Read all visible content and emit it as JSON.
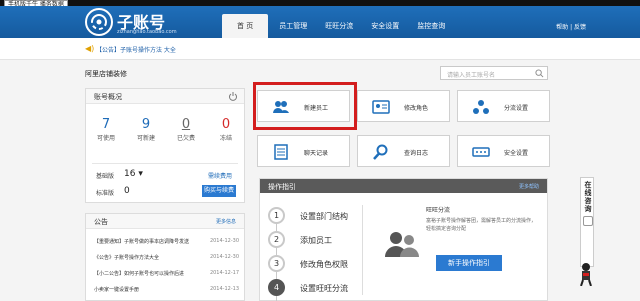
{
  "topbar": {
    "badge": "手机版千牛 播务数据"
  },
  "header": {
    "brand": "子账号",
    "brand_sub": "zizhanghao.taobao.com",
    "links": "帮助 | 反馈"
  },
  "nav": [
    {
      "label": "首 页",
      "active": true
    },
    {
      "label": "员工管理"
    },
    {
      "label": "旺旺分流"
    },
    {
      "label": "安全设置"
    },
    {
      "label": "监控查询"
    }
  ],
  "notice": {
    "text": "【公告】子账号操作方法 大全"
  },
  "store_title": "阿里店铺装修",
  "search": {
    "placeholder": "请输入员工账号名"
  },
  "account": {
    "title": "账号概况",
    "stats": [
      {
        "num": "7",
        "label": "可使用"
      },
      {
        "num": "9",
        "label": "可新建"
      },
      {
        "num": "0",
        "label": "已欠费"
      },
      {
        "num": "0",
        "label": "冻结"
      }
    ],
    "basic_label": "基础版",
    "basic_val": "16 ▾",
    "renew": "需续费用",
    "std_label": "标准版",
    "std_val": "0",
    "buy": "购买与续费"
  },
  "announcements": {
    "title": "公告",
    "more": "更多信息",
    "items": [
      {
        "text": "【重要通知】子账号做的事本店调降号发送",
        "date": "2014-12-30"
      },
      {
        "text": "《公告》子账号操作方法大全",
        "date": "2014-12-30"
      },
      {
        "text": "【小二公告】如何子账号也可以操作后进",
        "date": "2014-12-17"
      },
      {
        "text": "小卖家一键设置手册",
        "date": "2014-12-13"
      }
    ]
  },
  "tiles": [
    {
      "label": "新建员工",
      "icon": "add-employee-icon"
    },
    {
      "label": "修改角色",
      "icon": "edit-role-icon"
    },
    {
      "label": "分流设置",
      "icon": "distribution-icon"
    },
    {
      "label": "聊天记录",
      "icon": "chat-log-icon"
    },
    {
      "label": "查询日志",
      "icon": "query-log-icon"
    },
    {
      "label": "安全设置",
      "icon": "security-icon"
    }
  ],
  "guide": {
    "title": "操作指引",
    "more": "更多帮助",
    "steps": [
      {
        "n": "1",
        "label": "设置部门结构"
      },
      {
        "n": "2",
        "label": "添加员工"
      },
      {
        "n": "3",
        "label": "修改角色权限"
      },
      {
        "n": "4",
        "label": "设置旺旺分流"
      }
    ],
    "desc_title": "旺旺分流",
    "desc": "富裕子账号操作解答团，需解答员工的分流操作，轻松搞定咨询分配",
    "button": "新手操作指引"
  },
  "float": {
    "label": "在线咨询"
  }
}
